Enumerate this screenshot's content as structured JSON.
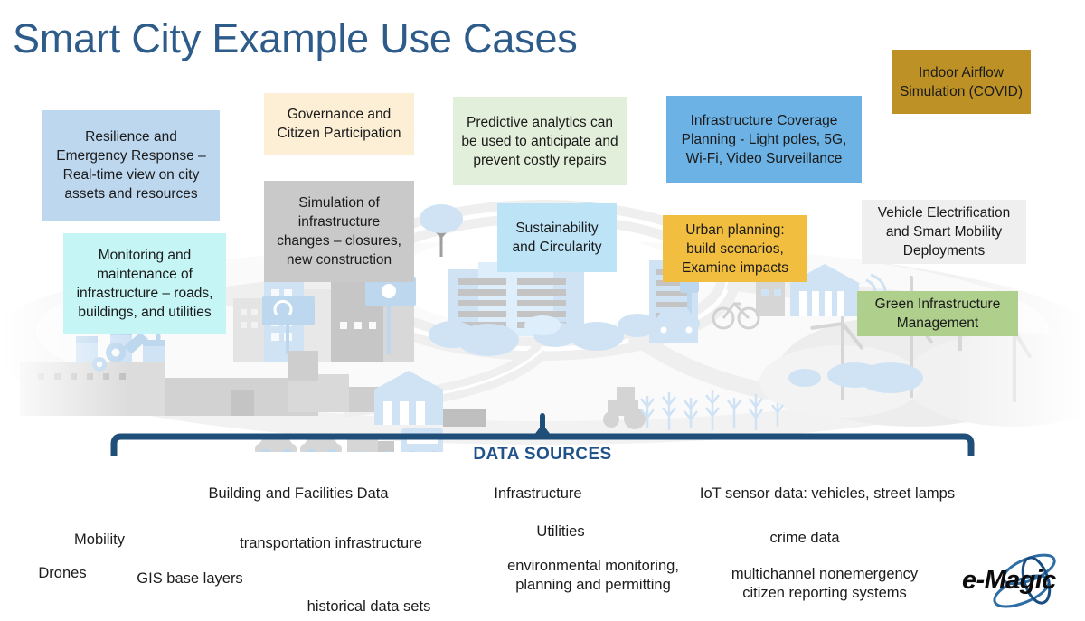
{
  "slide": {
    "title": "Smart City Example Use Cases",
    "title_color": "#2E5C8A",
    "background": "#FFFFFF"
  },
  "callouts": [
    {
      "id": "resilience",
      "text": "Resilience and Emergency Response – Real-time view on city assets and resources",
      "color": "#BDD7EE"
    },
    {
      "id": "monitoring",
      "text": "Monitoring and maintenance of infrastructure – roads, buildings, and utilities",
      "color": "#C6F5F5"
    },
    {
      "id": "governance",
      "text": "Governance and Citizen Participation",
      "color": "#FCEFD5"
    },
    {
      "id": "simulation",
      "text": "Simulation of infrastructure changes – closures, new construction",
      "color": "#C9C9C9"
    },
    {
      "id": "predictive",
      "text": "Predictive analytics can be used to anticipate and prevent costly repairs",
      "color": "#E2EFDA"
    },
    {
      "id": "sustainability",
      "text": "Sustainability and Circularity",
      "color": "#BDE3F7"
    },
    {
      "id": "coverage",
      "text": "Infrastructure Coverage Planning - Light poles, 5G, Wi-Fi, Video Surveillance",
      "color": "#6CB2E4"
    },
    {
      "id": "urban",
      "text": "Urban planning: build scenarios, Examine impacts",
      "color": "#F2BE3F"
    },
    {
      "id": "indoor",
      "text": "Indoor Airflow Simulation (COVID)",
      "color": "#BD9125"
    },
    {
      "id": "vehicle",
      "text": "Vehicle Electrification and Smart Mobility Deployments",
      "color": "#EFEFEF"
    },
    {
      "id": "green",
      "text": "Green Infrastructure Management",
      "color": "#AFCF8C"
    }
  ],
  "data_sources": {
    "label": "DATA SOURCES",
    "label_color": "#21538A",
    "bracket_color": "#1F4E79",
    "terms": [
      {
        "id": "building",
        "text": "Building and Facilities Data"
      },
      {
        "id": "infra",
        "text": "Infrastructure"
      },
      {
        "id": "iot",
        "text": "IoT sensor data: vehicles, street lamps"
      },
      {
        "id": "mobility",
        "text": "Mobility"
      },
      {
        "id": "utilities",
        "text": "Utilities"
      },
      {
        "id": "crime",
        "text": "crime data"
      },
      {
        "id": "transport",
        "text": "transportation infrastructure"
      },
      {
        "id": "drones",
        "text": "Drones"
      },
      {
        "id": "gis",
        "text": "GIS base layers"
      },
      {
        "id": "env",
        "text": "environmental monitoring,\nplanning and permitting"
      },
      {
        "id": "multichannel",
        "text": "multichannel nonemergency\ncitizen reporting systems"
      },
      {
        "id": "historical",
        "text": "historical data sets"
      }
    ]
  },
  "logo": {
    "text": "e-Magic",
    "ring_color": "#2E6DA4"
  }
}
